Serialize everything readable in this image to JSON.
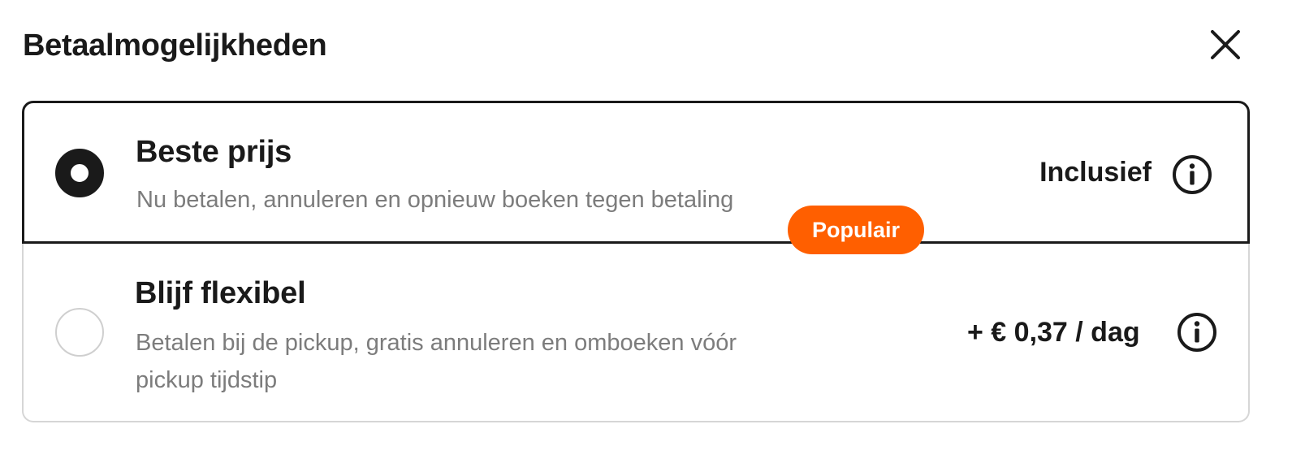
{
  "dialog": {
    "title": "Betaalmogelijkheden",
    "close_icon": "close-icon"
  },
  "options": [
    {
      "title": "Beste prijs",
      "description": "Nu betalen, annuleren en opnieuw boeken tegen betaling",
      "price": "Inclusief",
      "selected": true,
      "info_icon": "info-icon"
    },
    {
      "title": "Blijf flexibel",
      "description": "Betalen bij de pickup, gratis annuleren en omboeken vóór pickup tijdstip",
      "badge": "Populair",
      "price": "+ € 0,37 / dag",
      "selected": false,
      "info_icon": "info-icon"
    }
  ],
  "colors": {
    "text": "#1a1a1a",
    "muted": "#7c7c7c",
    "badge": "#ff5f00",
    "border_unselected": "#d6d6d6"
  }
}
